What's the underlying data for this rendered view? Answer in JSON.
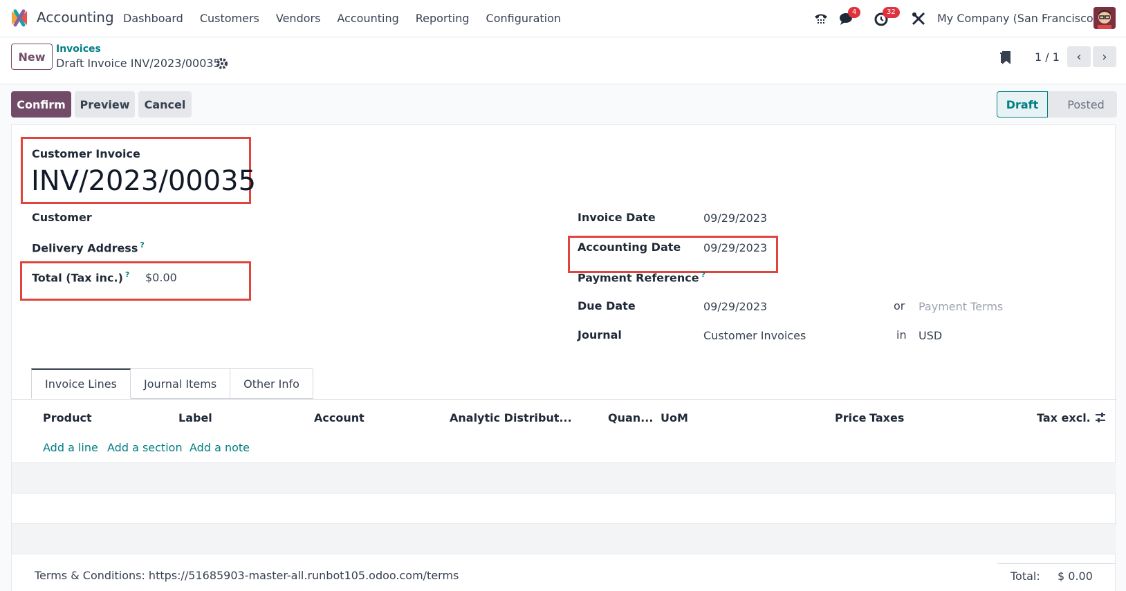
{
  "navbar": {
    "app_name": "Accounting",
    "menu": [
      "Dashboard",
      "Customers",
      "Vendors",
      "Accounting",
      "Reporting",
      "Configuration"
    ],
    "messages_badge": "4",
    "activities_badge": "32",
    "company": "My Company (San Francisco)"
  },
  "control": {
    "new_label": "New",
    "breadcrumb_parent": "Invoices",
    "breadcrumb_current": "Draft Invoice INV/2023/00035",
    "pager": "1 / 1"
  },
  "actions": {
    "confirm": "Confirm",
    "preview": "Preview",
    "cancel": "Cancel"
  },
  "status": {
    "stages": [
      "Draft",
      "Posted"
    ],
    "active": "Draft"
  },
  "form": {
    "type_label": "Customer Invoice",
    "number": "INV/2023/00035",
    "left": {
      "customer_label": "Customer",
      "delivery_label": "Delivery Address",
      "total_label": "Total (Tax inc.)",
      "total_value": "$0.00"
    },
    "right": {
      "invoice_date_label": "Invoice Date",
      "invoice_date": "09/29/2023",
      "accounting_date_label": "Accounting Date",
      "accounting_date": "09/29/2023",
      "payment_ref_label": "Payment Reference",
      "due_date_label": "Due Date",
      "due_date": "09/29/2023",
      "or_text": "or",
      "payment_terms_placeholder": "Payment Terms",
      "journal_label": "Journal",
      "journal": "Customer Invoices",
      "in_text": "in",
      "currency": "USD"
    },
    "help_mark": "?"
  },
  "tabs": [
    "Invoice Lines",
    "Journal Items",
    "Other Info"
  ],
  "lines": {
    "columns": [
      "Product",
      "Label",
      "Account",
      "Analytic Distribut...",
      "Quan...",
      "UoM",
      "Price",
      "Taxes",
      "Tax excl."
    ],
    "add_line": "Add a line",
    "add_section": "Add a section",
    "add_note": "Add a note"
  },
  "footer": {
    "terms": "Terms & Conditions: https://51685903-master-all.runbot105.odoo.com/terms",
    "total_label": "Total:",
    "total_value": "$ 0.00"
  },
  "colors": {
    "brand": "#714b67",
    "link": "#017e84",
    "highlight": "#e0443a"
  }
}
